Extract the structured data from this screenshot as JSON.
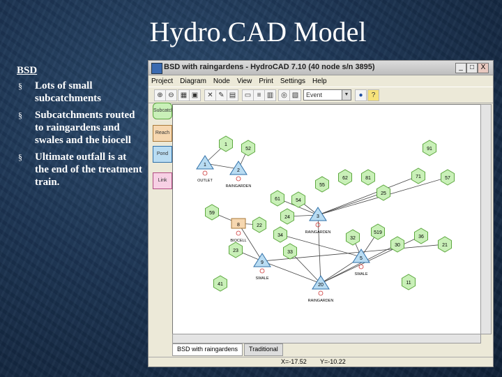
{
  "slide": {
    "title": "Hydro.CAD Model",
    "heading": "BSD",
    "bullet_mark": "§",
    "bullets": [
      "Lots of small subcatchments",
      "Subcatchments routed to raingardens and swales and the biocell",
      "Ultimate outfall is at the end of the treatment train."
    ]
  },
  "window": {
    "title": "BSD with raingardens - HydroCAD 7.10 (40 node s/n 3895)",
    "controls": {
      "minimize": "_",
      "maximize": "□",
      "close": "X"
    },
    "menu": [
      "Project",
      "Diagram",
      "Node",
      "View",
      "Print",
      "Settings",
      "Help"
    ],
    "toolbar": {
      "combo_value": "Event",
      "combo_icon": "▼"
    },
    "palette": [
      "Subcatch",
      "Reach",
      "Pond",
      "Link"
    ],
    "tabs": [
      "BSD with raingardens",
      "Traditional"
    ],
    "status": {
      "x": "X=-17.52",
      "y": "Y=-10.22"
    }
  },
  "diagram": {
    "subcatchments": [
      "1",
      "52",
      "91",
      "55",
      "62",
      "81",
      "71",
      "57",
      "25",
      "59",
      "61",
      "54",
      "24",
      "22",
      "34",
      "519",
      "32",
      "30",
      "36",
      "21",
      "23",
      "33",
      "11",
      "41"
    ],
    "nodes": [
      "1",
      "2",
      "3",
      "8",
      "9",
      "5",
      "20"
    ],
    "labels": [
      "OUTLET",
      "RAINGARDEN",
      "RAINGARDEN",
      "BIOCELL",
      "SWALE",
      "SWALE",
      "RAINGARDEN",
      "OUTLET"
    ]
  },
  "colors": {
    "subcatch_fill": "#c9f0b8",
    "subcatch_stroke": "#5da83f",
    "node_fill": "#b9dcf2",
    "node_stroke": "#2e6fa8"
  }
}
